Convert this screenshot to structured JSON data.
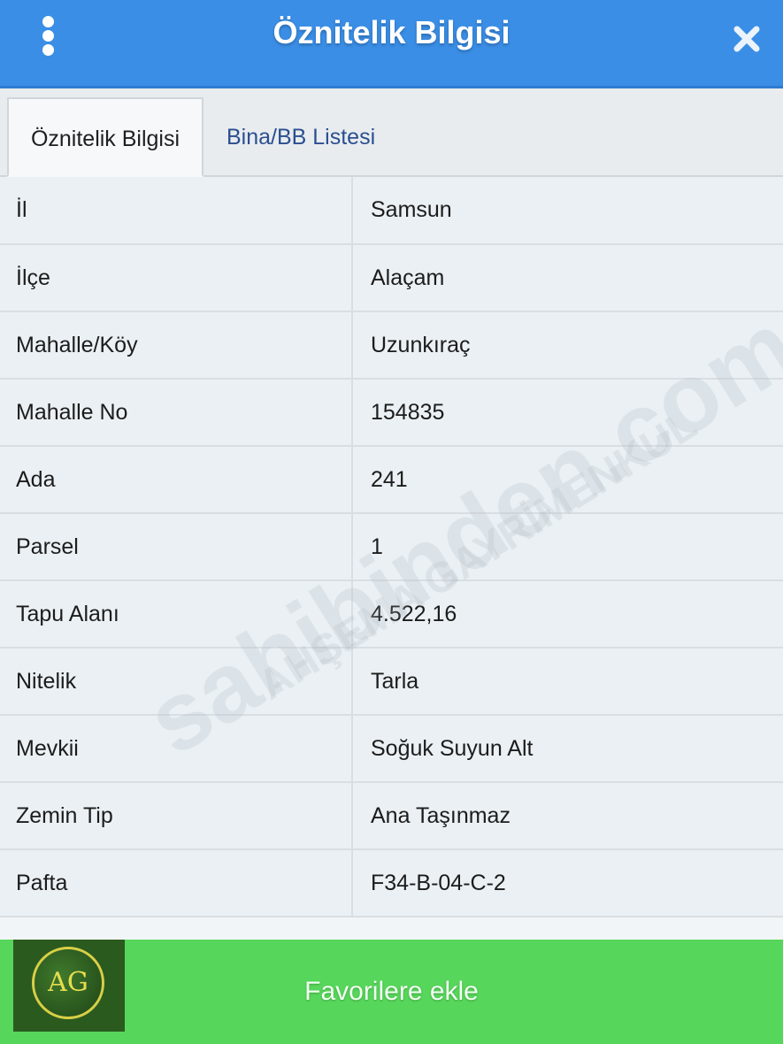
{
  "header": {
    "title": "Öznitelik Bilgisi",
    "menu_icon": "vertical-dots-icon",
    "close_icon": "close-x-icon"
  },
  "tabs": [
    {
      "label": "Öznitelik Bilgisi",
      "active": true
    },
    {
      "label": "Bina/BB Listesi",
      "active": false
    }
  ],
  "attributes": [
    {
      "key": "İl",
      "value": "Samsun"
    },
    {
      "key": "İlçe",
      "value": "Alaçam"
    },
    {
      "key": "Mahalle/Köy",
      "value": "Uzunkıraç"
    },
    {
      "key": "Mahalle No",
      "value": "154835"
    },
    {
      "key": "Ada",
      "value": "241"
    },
    {
      "key": "Parsel",
      "value": "1"
    },
    {
      "key": "Tapu Alanı",
      "value": "4.522,16"
    },
    {
      "key": "Nitelik",
      "value": "Tarla"
    },
    {
      "key": "Mevkii",
      "value": "Soğuk Suyun Alt"
    },
    {
      "key": "Zemin Tip",
      "value": "Ana Taşınmaz"
    },
    {
      "key": "Pafta",
      "value": "F34-B-04-C-2"
    }
  ],
  "watermark": {
    "primary": "sahibinden.com",
    "secondary": "AHŞEMA GAYRİMENKUL"
  },
  "footer": {
    "button_label": "Favorilere ekle",
    "logo_text": "AG"
  },
  "colors": {
    "header": "#3a8ee6",
    "footer": "#56d65a",
    "row_bg": "#eaf0f4"
  }
}
